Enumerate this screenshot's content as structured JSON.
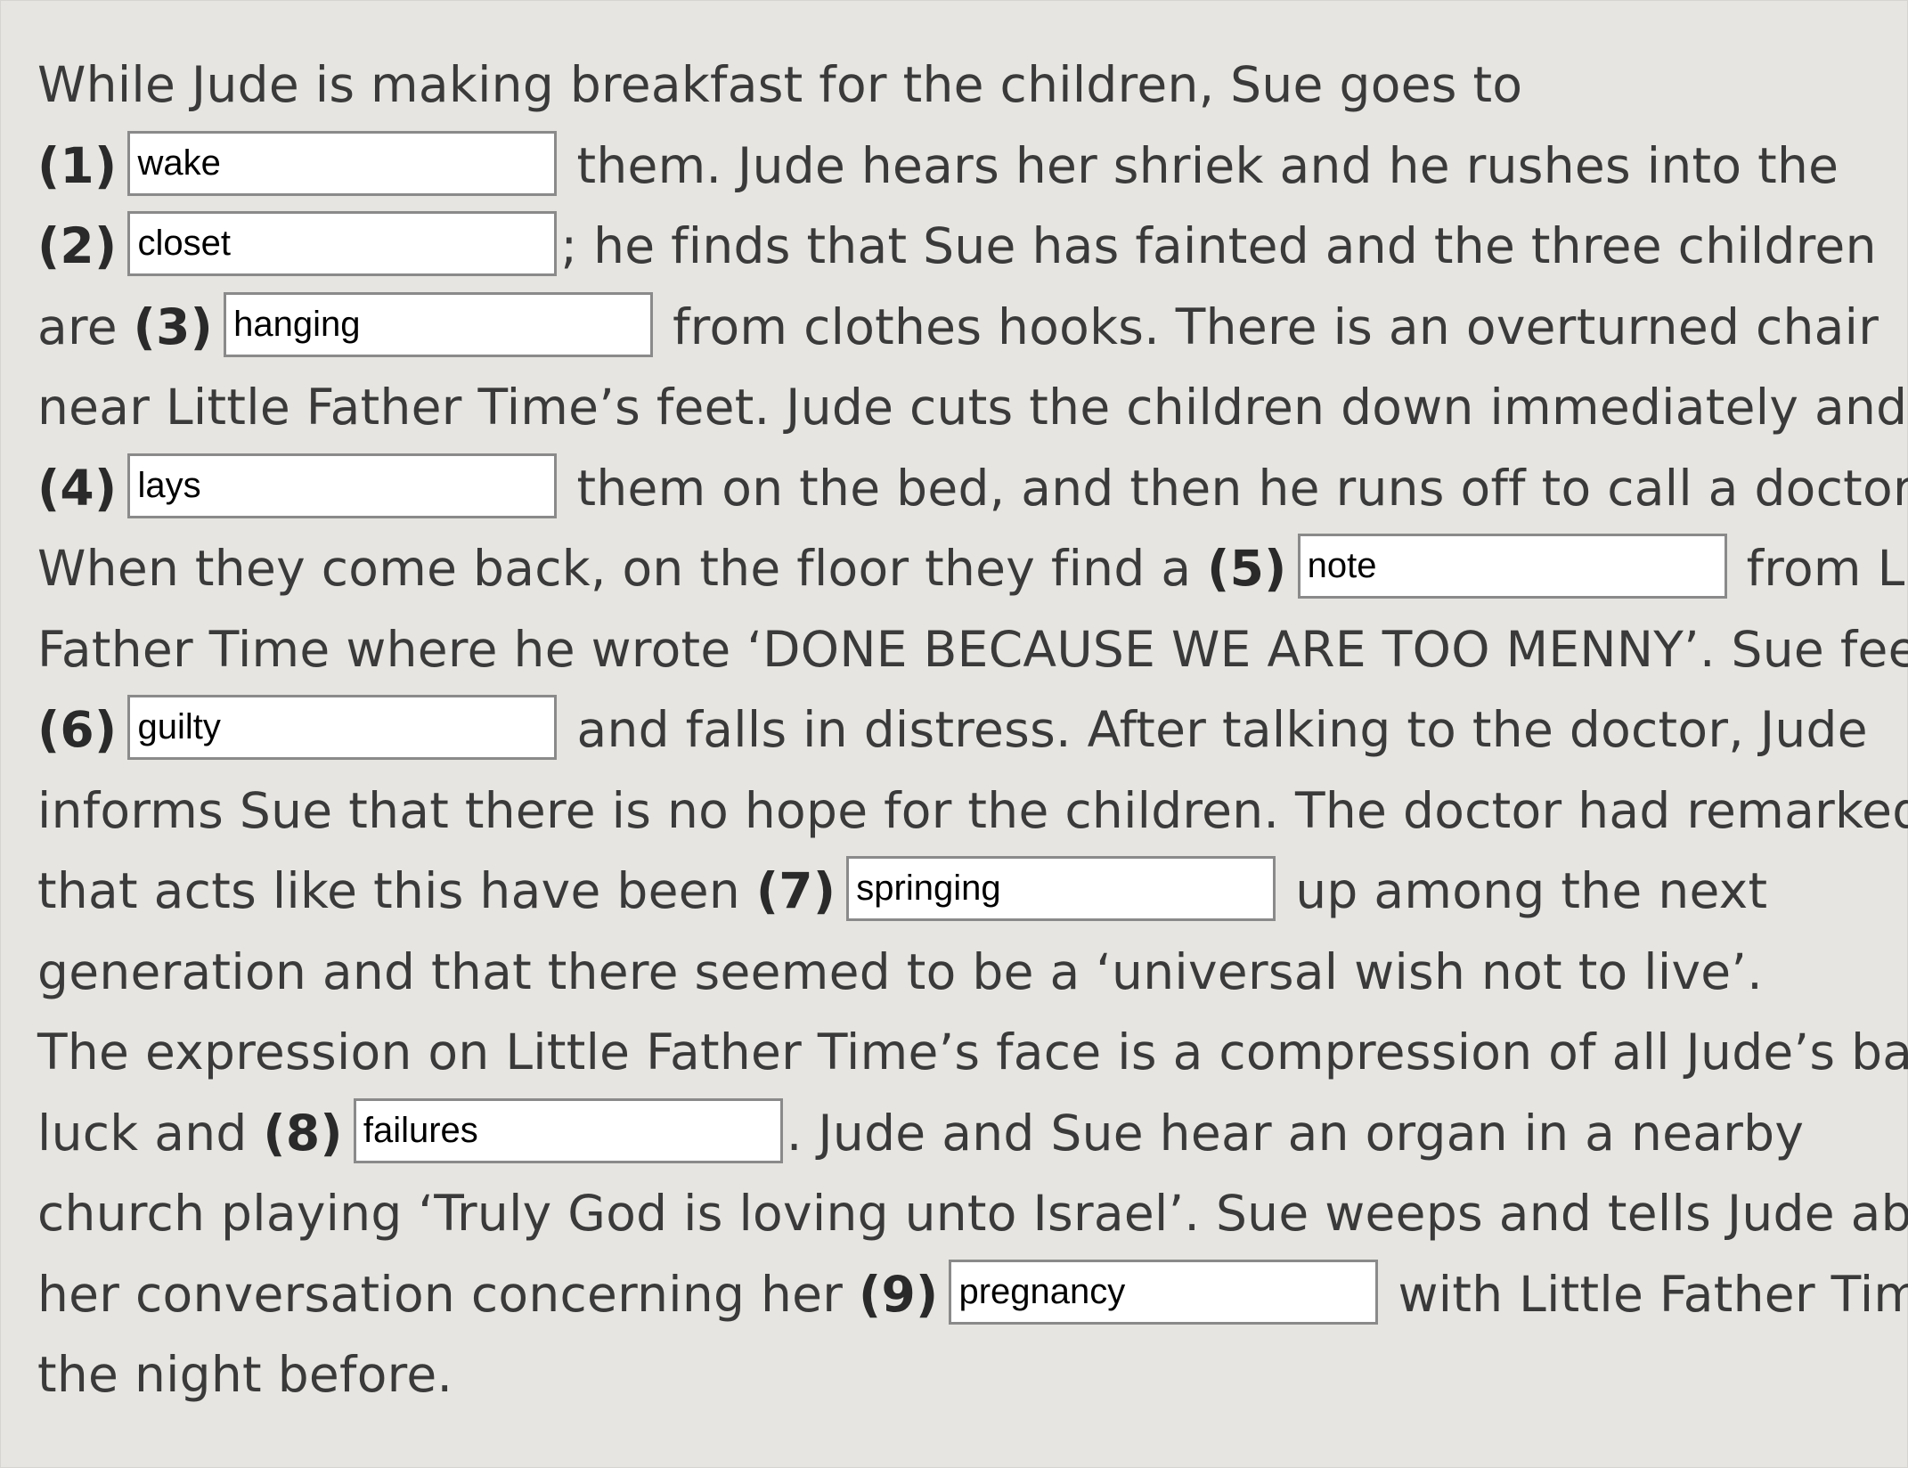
{
  "passage": {
    "line1": "While Jude is making breakfast for the children, Sue goes to",
    "n1": "(1)",
    "a1": "them. Jude hears her shriek and he rushes into the",
    "n2": "(2)",
    "a2": "; he finds that Sue has fainted and the three children",
    "b3": "are",
    "n3": "(3)",
    "a3": "from clothes hooks. There is an overturned chair",
    "line5": "near Little Father Time’s feet. Jude cuts the children down immediately and",
    "n4": "(4)",
    "a4": "them on the bed, and then he runs off to call a doctor.",
    "b5": "When they come back, on the floor they find a",
    "n5": "(5)",
    "a5": "from Little",
    "line8": "Father Time where he wrote ‘DONE BECAUSE WE ARE TOO MENNY’. Sue feels",
    "n6": "(6)",
    "a6": "and falls in distress. After talking to the doctor, Jude",
    "line10": "informs Sue that there is no hope for the children. The doctor had remarked",
    "b7": "that acts like this have been",
    "n7": "(7)",
    "a7": "up among the next",
    "line12": "generation and that there seemed to be a ‘universal wish not to live’.",
    "line13": "The expression on Little Father Time’s face is a compression of all Jude’s bad",
    "b8": "luck and",
    "n8": "(8)",
    "a8": ". Jude and Sue hear an organ in a nearby",
    "line15": "church playing ‘Truly God is loving unto Israel’. Sue weeps and tells Jude about",
    "b9": "her conversation concerning her",
    "n9": "(9)",
    "a9": "with Little Father Time",
    "line17": "the night before."
  },
  "answers": {
    "blank1": "wake",
    "blank2": "closet",
    "blank3": "hanging",
    "blank4": "lays",
    "blank5": "note",
    "blank6": "guilty",
    "blank7": "springing",
    "blank8": "failures",
    "blank9": "pregnancy"
  }
}
